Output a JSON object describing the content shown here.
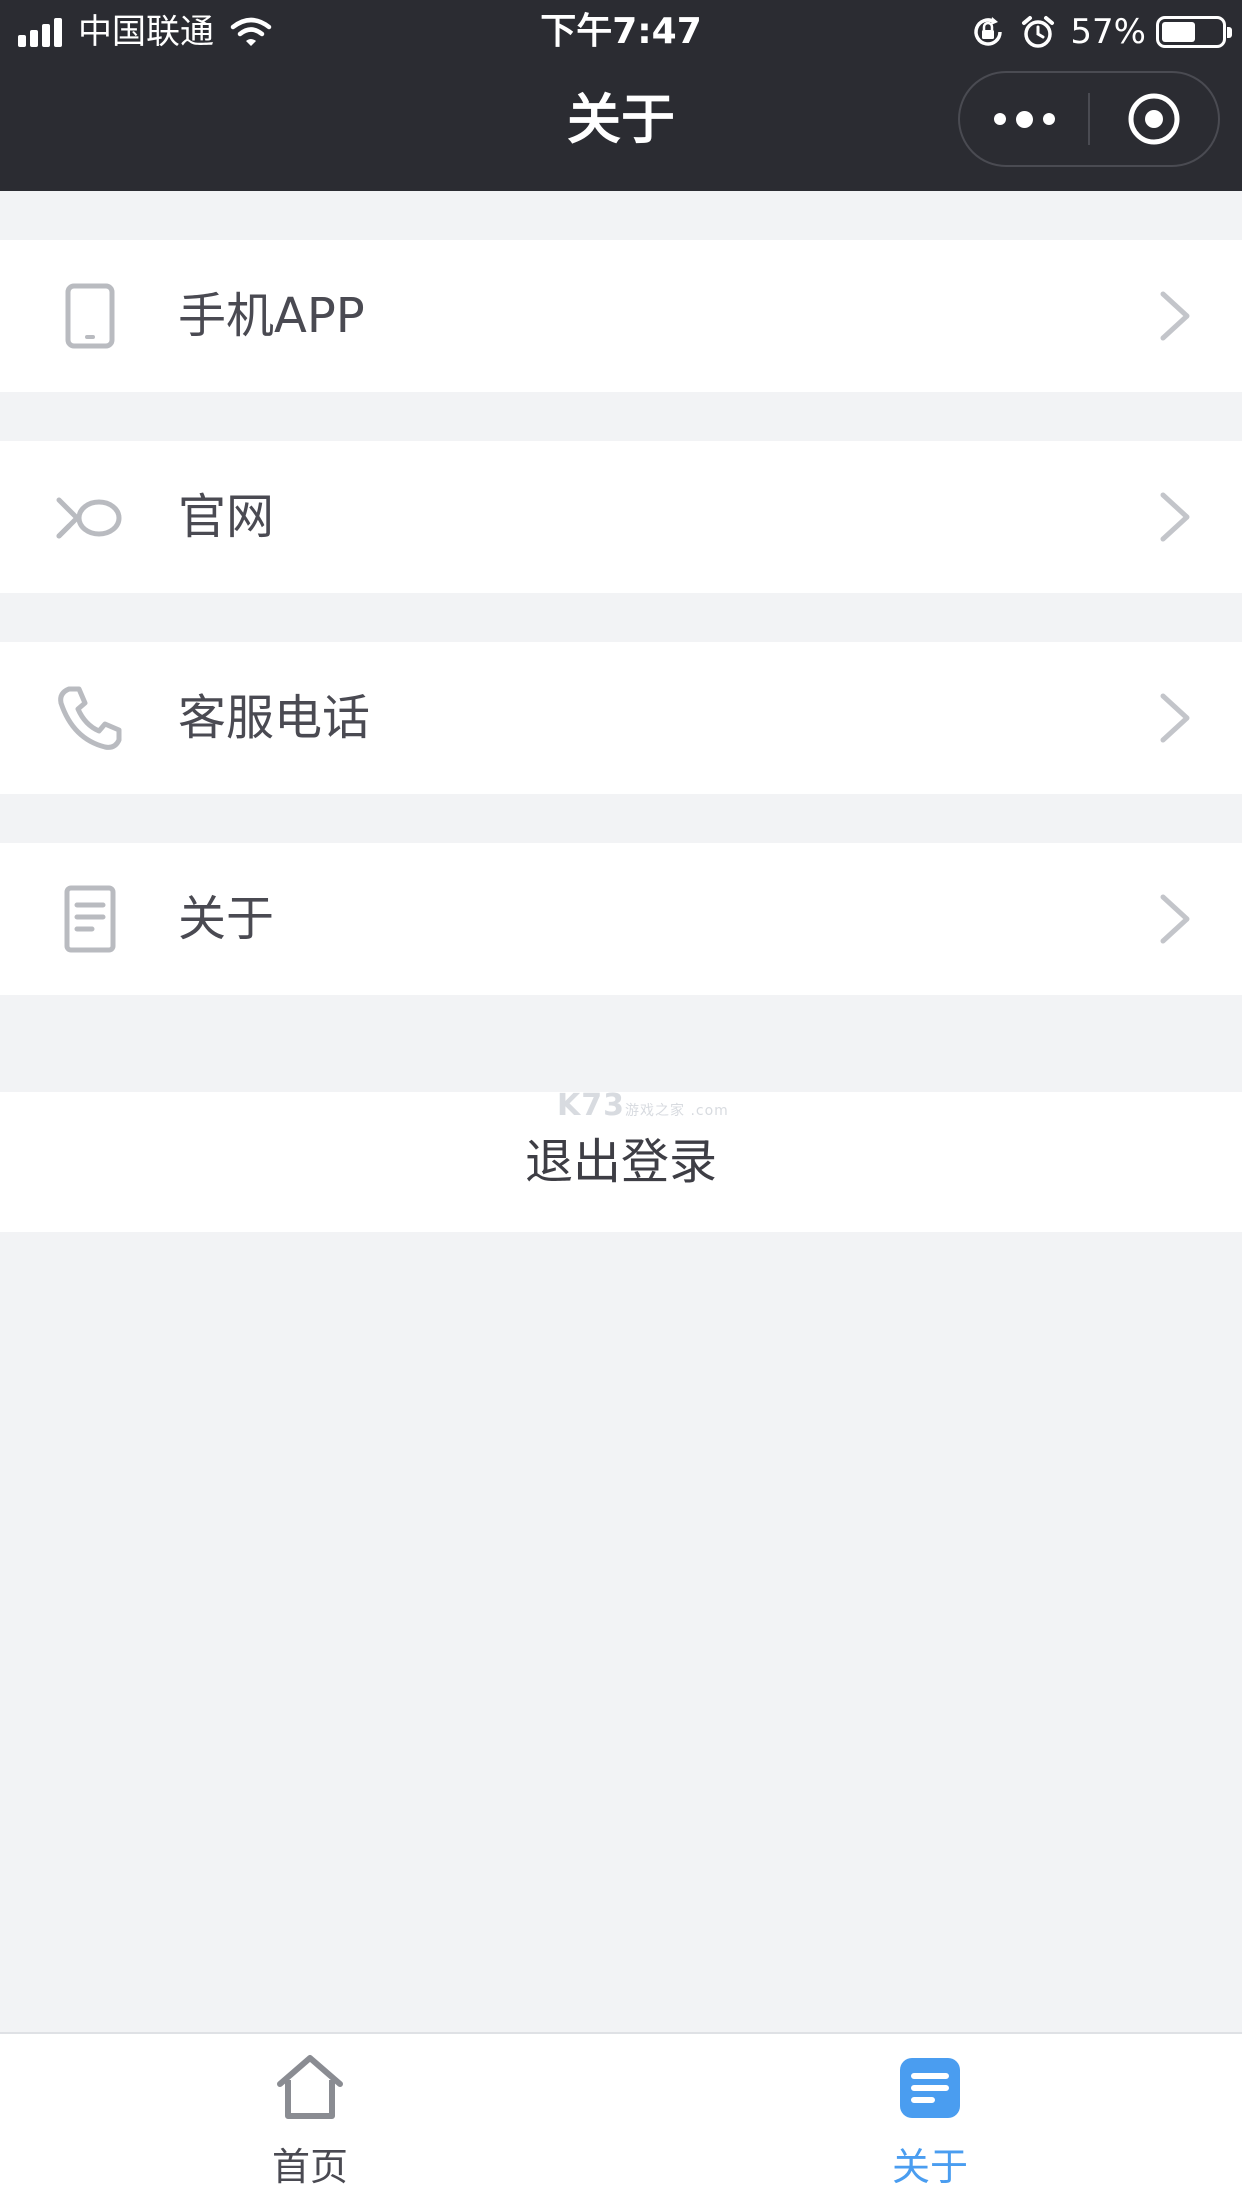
{
  "status_bar": {
    "carrier": "中国联通",
    "time": "下午7:47",
    "battery_percent": "57%",
    "battery_level": 0.57,
    "icons": [
      "signal-icon",
      "wifi-icon",
      "orientation-lock-icon",
      "alarm-icon",
      "battery-icon"
    ]
  },
  "nav_bar": {
    "title": "关于",
    "capsule": [
      "more-dots-icon",
      "close-circle-icon"
    ]
  },
  "menu": {
    "items": [
      {
        "label": "手机APP",
        "icon": "phone-device-icon"
      },
      {
        "label": "官网",
        "icon": "website-icon"
      },
      {
        "label": "客服电话",
        "icon": "telephone-icon"
      },
      {
        "label": "关于",
        "icon": "document-icon"
      }
    ],
    "logout_label": "退出登录"
  },
  "watermark": {
    "text": "K73",
    "subtext": "游戏之家 .com"
  },
  "tab_bar": {
    "tabs": [
      {
        "label": "首页",
        "icon": "home-icon",
        "active": false
      },
      {
        "label": "关于",
        "icon": "list-doc-icon",
        "active": true
      }
    ]
  },
  "colors": {
    "header_bg": "#2b2c32",
    "page_bg": "#f2f3f5",
    "accent": "#4a9df0",
    "icon_gray": "#b9bbc0",
    "text": "#4a4a52"
  }
}
